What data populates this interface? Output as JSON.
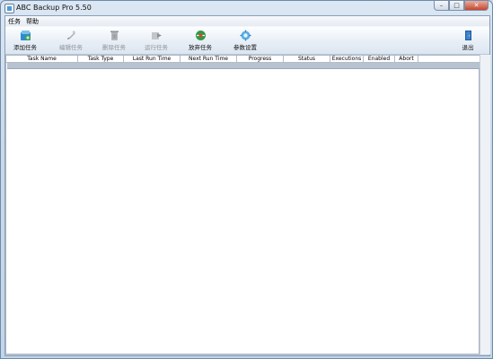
{
  "window": {
    "title": "ABC Backup Pro 5.50",
    "controls": {
      "minimize": "–",
      "maximize": "□",
      "close": "✕"
    }
  },
  "menu": {
    "items": [
      "任务",
      "帮助"
    ]
  },
  "toolbar": {
    "buttons": [
      {
        "label": "添加任务",
        "icon": "add-task-icon",
        "enabled": true
      },
      {
        "label": "编辑任务",
        "icon": "edit-task-icon",
        "enabled": false
      },
      {
        "label": "删除任务",
        "icon": "delete-task-icon",
        "enabled": false
      },
      {
        "label": "运行任务",
        "icon": "run-task-icon",
        "enabled": false
      },
      {
        "label": "放弃任务",
        "icon": "abandon-task-icon",
        "enabled": true
      },
      {
        "label": "参数设置",
        "icon": "settings-icon",
        "enabled": true
      }
    ],
    "exit": {
      "label": "退出",
      "icon": "exit-door-icon"
    }
  },
  "table": {
    "columns": [
      "Task Name",
      "Task Type",
      "Last Run Time",
      "Next Run Time",
      "Progress",
      "Status",
      "Executions",
      "Enabled",
      "Abort"
    ],
    "rows": []
  },
  "colors": {
    "accent": "#4d9bd8",
    "window_frame": "#c9d9ea",
    "band": "#b7c3d0"
  }
}
